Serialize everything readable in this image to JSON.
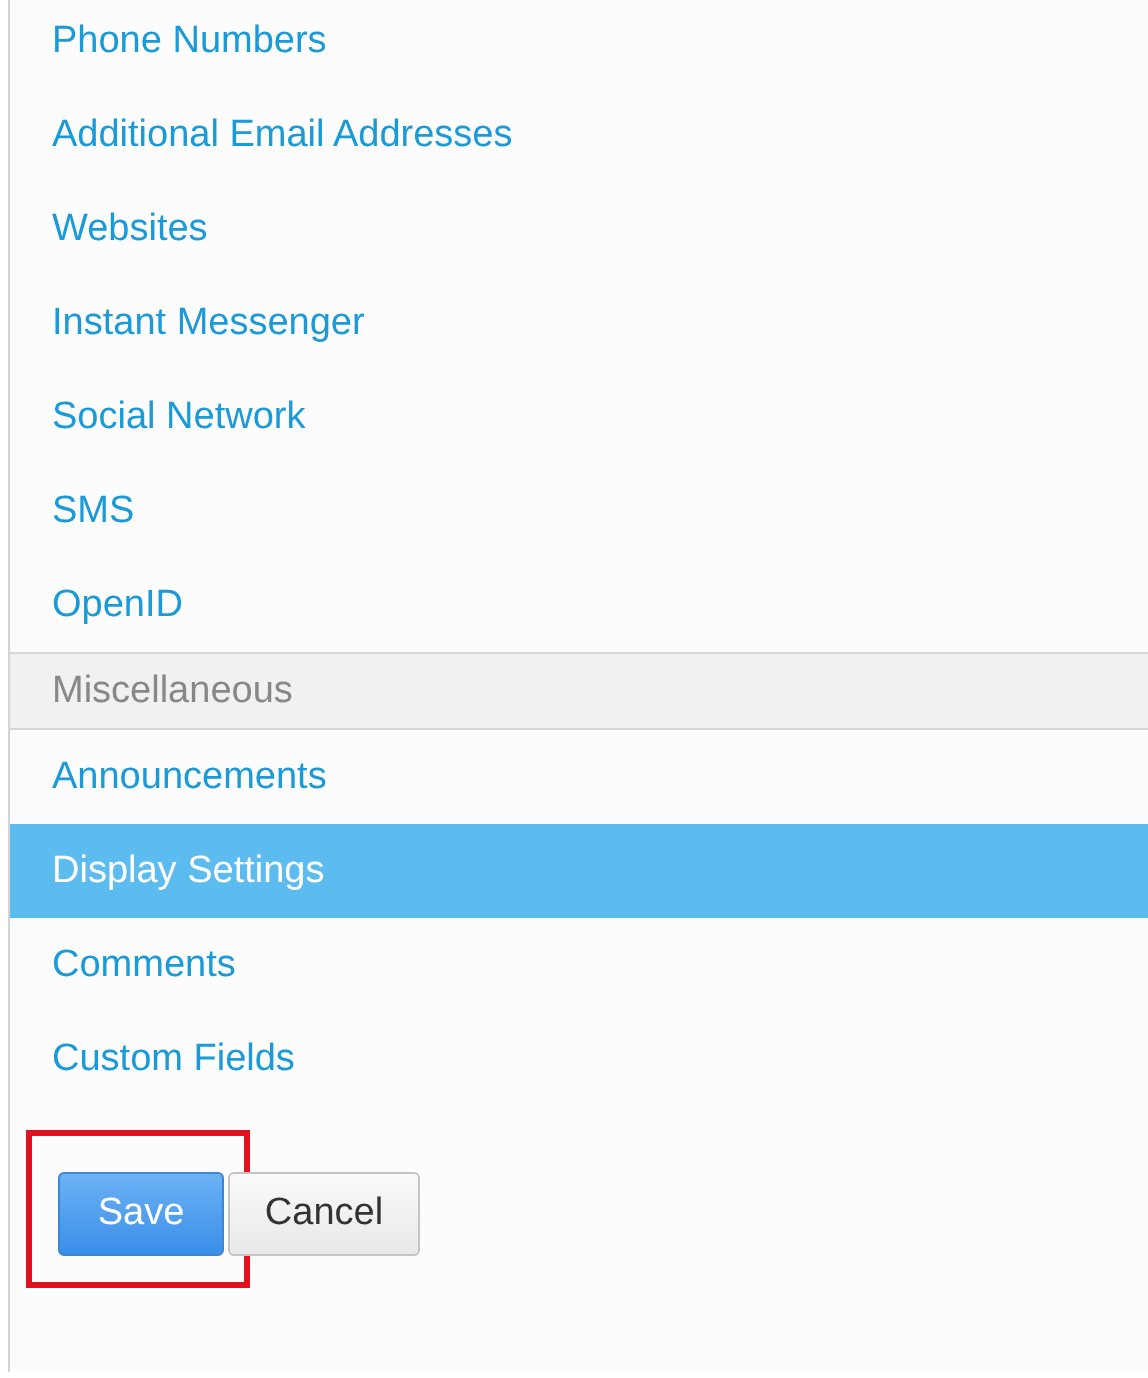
{
  "contact_items": [
    {
      "label": "Phone Numbers",
      "selected": false
    },
    {
      "label": "Additional Email Addresses",
      "selected": false
    },
    {
      "label": "Websites",
      "selected": false
    },
    {
      "label": "Instant Messenger",
      "selected": false
    },
    {
      "label": "Social Network",
      "selected": false
    },
    {
      "label": "SMS",
      "selected": false
    },
    {
      "label": "OpenID",
      "selected": false
    }
  ],
  "section": {
    "title": "Miscellaneous",
    "items": [
      {
        "label": "Announcements",
        "selected": false
      },
      {
        "label": "Display Settings",
        "selected": true
      },
      {
        "label": "Comments",
        "selected": false
      },
      {
        "label": "Custom Fields",
        "selected": false
      }
    ]
  },
  "buttons": [
    {
      "label": "Save",
      "kind": "primary",
      "highlighted": true
    },
    {
      "label": "Cancel",
      "kind": "secondary",
      "highlighted": false
    }
  ]
}
